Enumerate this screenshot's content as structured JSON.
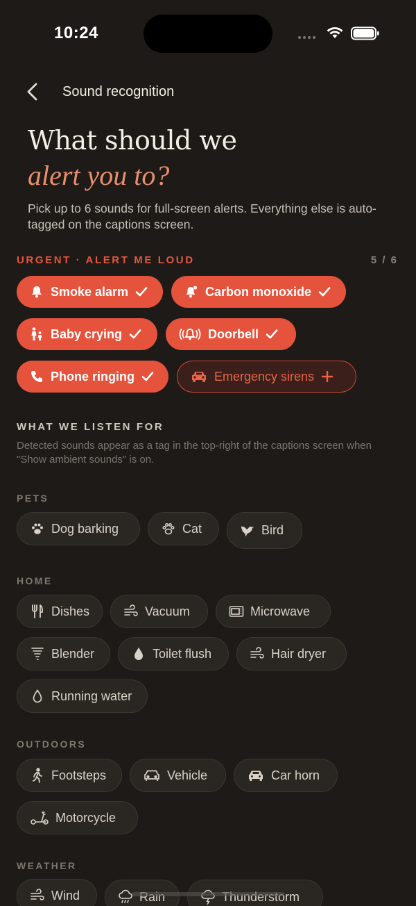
{
  "status": {
    "time": "10:24"
  },
  "nav": {
    "title": "Sound recognition"
  },
  "hero": {
    "title_line1": "What should we",
    "title_line2": "alert you to?",
    "subtitle": "Pick up to 6 sounds for full-screen alerts. Everything else is auto-tagged on the captions screen."
  },
  "urgent": {
    "label": "URGENT · ALERT ME LOUD",
    "count": "5 / 6",
    "chips": [
      {
        "label": "Smoke alarm",
        "icon": "bell-icon",
        "selected": true
      },
      {
        "label": "Carbon monoxide",
        "icon": "bell-alert-icon",
        "selected": true
      },
      {
        "label": "Baby crying",
        "icon": "family-icon",
        "selected": true
      },
      {
        "label": "Doorbell",
        "icon": "ringing-bell-icon",
        "selected": true
      },
      {
        "label": "Phone ringing",
        "icon": "phone-icon",
        "selected": true
      },
      {
        "label": "Emergency sirens",
        "icon": "car-icon",
        "selected": false
      }
    ]
  },
  "listen": {
    "label": "WHAT WE LISTEN FOR",
    "note": "Detected sounds appear as a tag in the top-right of the captions screen when \"Show ambient sounds\" is on.",
    "categories": [
      {
        "name": "PETS",
        "items": [
          "Dog barking",
          "Cat",
          "Bird"
        ]
      },
      {
        "name": "HOME",
        "items": [
          "Dishes",
          "Vacuum",
          "Microwave",
          "Blender",
          "Toilet flush",
          "Hair dryer",
          "Running water"
        ]
      },
      {
        "name": "OUTDOORS",
        "items": [
          "Footsteps",
          "Vehicle",
          "Car horn",
          "Motorcycle"
        ]
      },
      {
        "name": "WEATHER",
        "items": [
          "Wind",
          "Rain",
          "Thunderstorm"
        ]
      }
    ]
  },
  "colors": {
    "accent": "#e5533d",
    "background": "#1d1a17",
    "italic_accent": "#e98e6e"
  }
}
